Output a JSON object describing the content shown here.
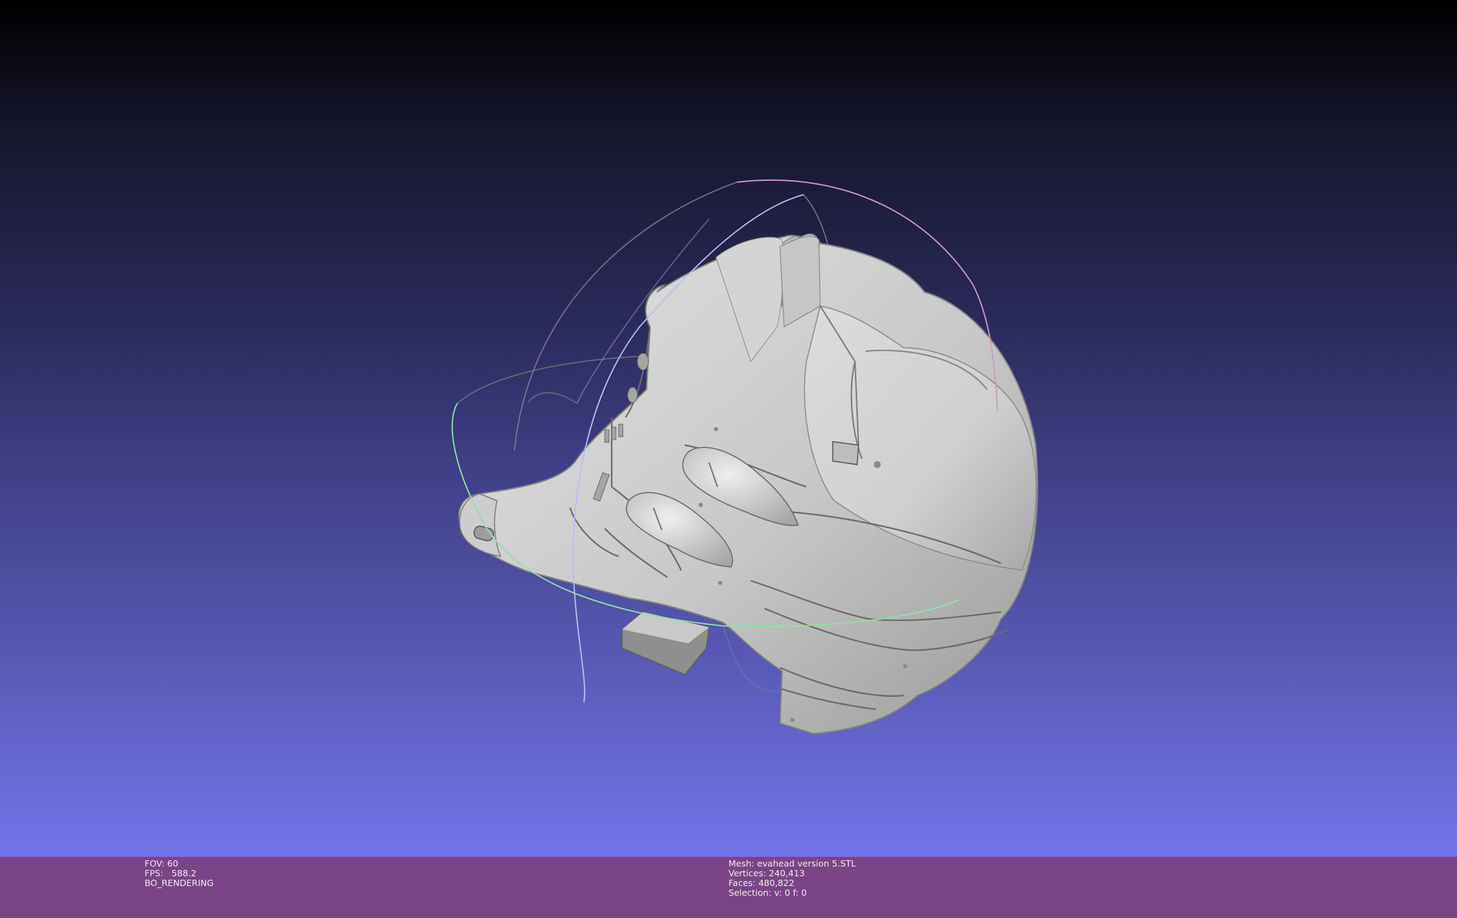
{
  "viewport": {
    "model": "helmet-mesh",
    "trackball": true,
    "background_colors": [
      "#000000",
      "#7474ea"
    ]
  },
  "info_bar": {
    "background": "#7a4585",
    "fov": "FOV: 60",
    "fps": "FPS:   588.2",
    "render_mode": "BO_RENDERING",
    "mesh": "Mesh: evahead version 5.STL",
    "vertices": "Vertices: 240,413",
    "faces": "Faces: 480,822",
    "selection": "Selection: v: 0 f: 0"
  }
}
